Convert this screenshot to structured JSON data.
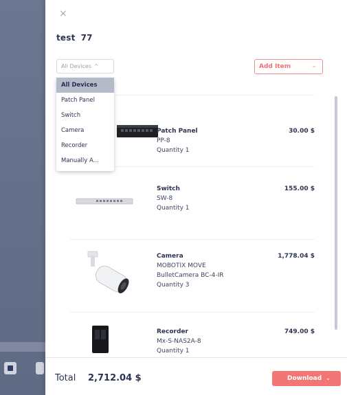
{
  "drawer": {
    "close_glyph": "×",
    "project_name": "test",
    "project_number": "77"
  },
  "filter": {
    "selected": "All Devices",
    "options": [
      "All Devices",
      "Patch Panel",
      "Switch",
      "Camera",
      "Recorder",
      "Manually A..."
    ]
  },
  "add_item": {
    "label": "Add Item"
  },
  "items": [
    {
      "name": "Patch Panel",
      "lines": [
        "PP-8",
        "Quantity 1"
      ],
      "price": "30.00 $",
      "icon": "patch-panel-image"
    },
    {
      "name": "Switch",
      "lines": [
        "SW-8",
        "Quantity 1"
      ],
      "price": "155.00 $",
      "icon": "switch-image"
    },
    {
      "name": "Camera",
      "lines": [
        "MOBOTIX MOVE",
        "BulletCamera BC-4-IR",
        "Quantity 3"
      ],
      "price": "1,778.04 $",
      "icon": "bullet-camera-image"
    },
    {
      "name": "Recorder",
      "lines": [
        "Mx-S-NAS2A-8",
        "Quantity 1"
      ],
      "price": "749.00 $",
      "icon": "recorder-image"
    }
  ],
  "footer": {
    "total_label": "Total",
    "total_value": "2,712.04 $",
    "download_label": "Download"
  },
  "colors": {
    "accent": "#f27676",
    "text": "#2d3350",
    "backdrop": "#6b7690"
  }
}
